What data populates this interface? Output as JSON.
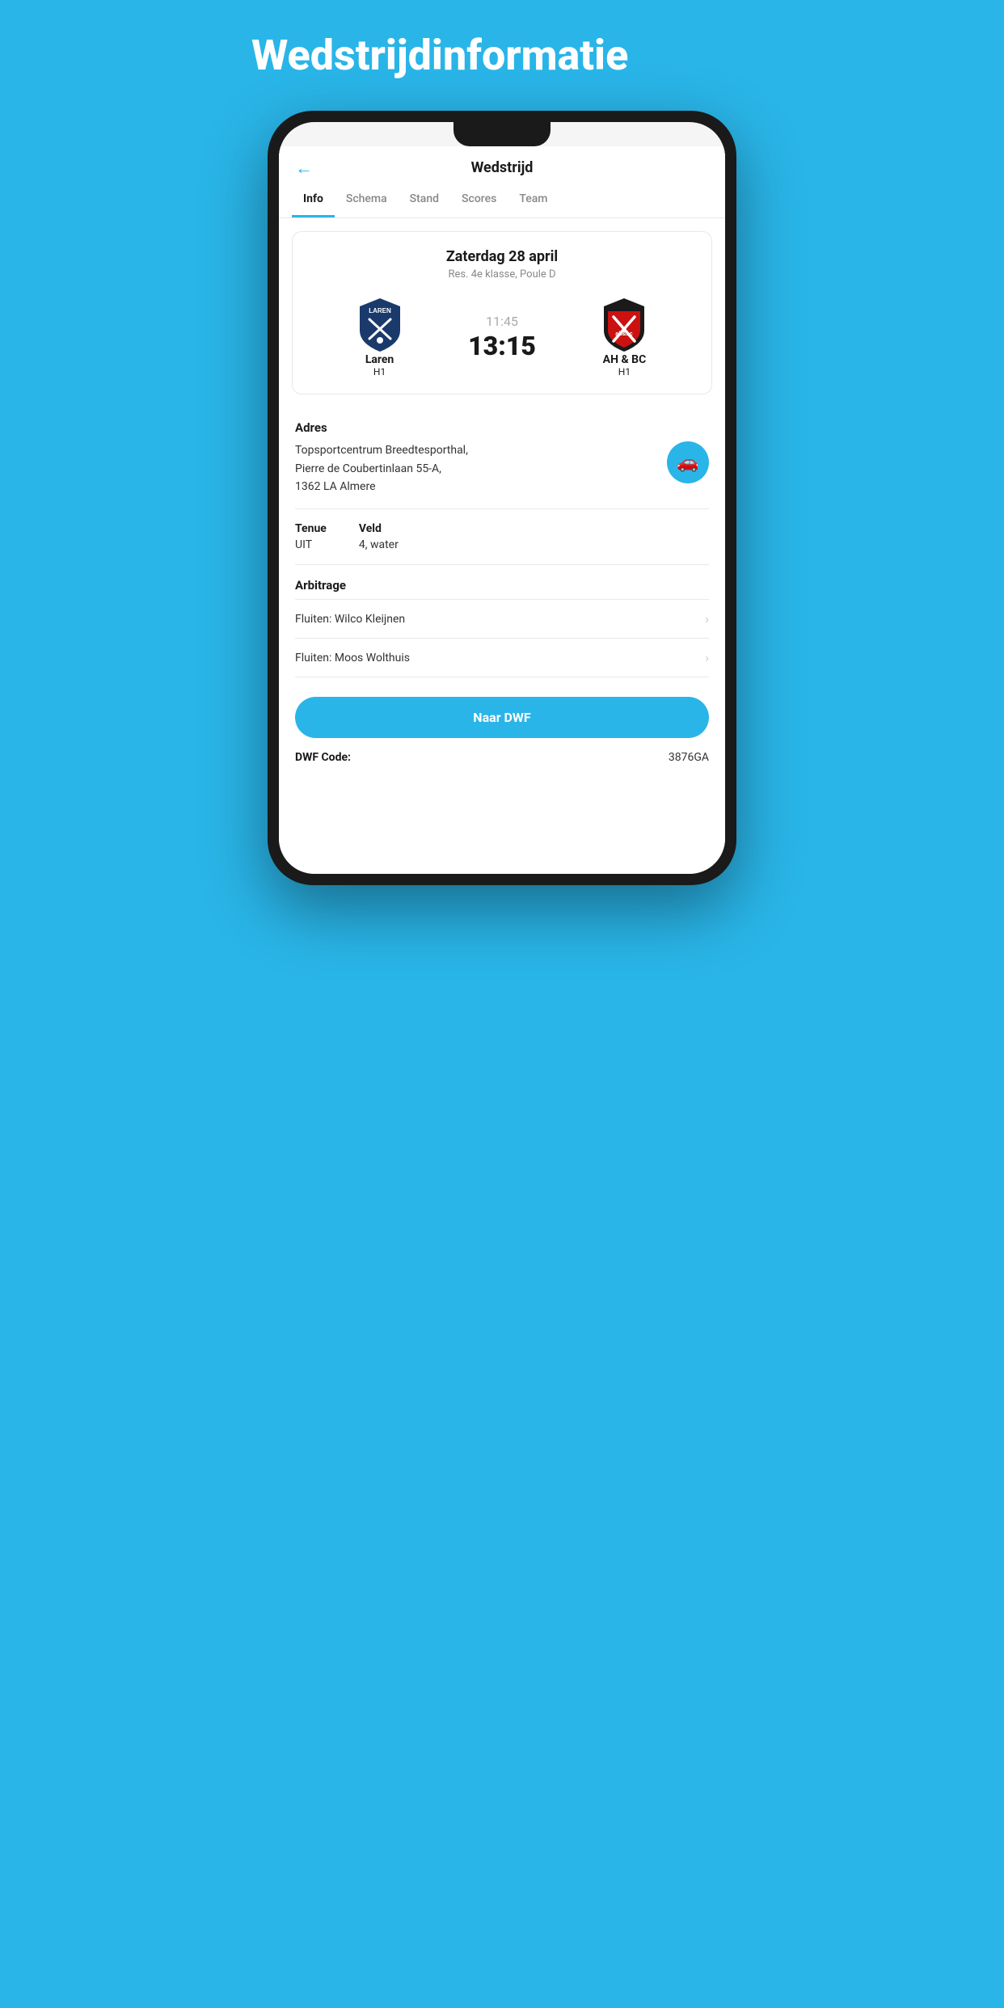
{
  "pageTitle": "Wedstrijdinformatie",
  "header": {
    "title": "Wedstrijd",
    "backLabel": "←"
  },
  "tabs": [
    {
      "id": "info",
      "label": "Info",
      "active": true
    },
    {
      "id": "schema",
      "label": "Schema",
      "active": false
    },
    {
      "id": "stand",
      "label": "Stand",
      "active": false
    },
    {
      "id": "scores",
      "label": "Scores",
      "active": false
    },
    {
      "id": "team",
      "label": "Team",
      "active": false
    }
  ],
  "match": {
    "date": "Zaterdag 28 april",
    "competition": "Res. 4e klasse, Poule D",
    "timeScheduled": "11:45",
    "timeActual": "13:15",
    "homeTeam": {
      "name": "Laren",
      "sub": "H1"
    },
    "awayTeam": {
      "name": "AH & BC",
      "sub": "H1"
    }
  },
  "info": {
    "addressLabel": "Adres",
    "addressText": "Topsportcentrum Breedtesporthal,\nPierre de Coubertinlaan 55-A,\n1362 LA Almere",
    "tenueLabel": "Tenue",
    "tenueValue": "UIT",
    "veldLabel": "Veld",
    "veldValue": "4, water",
    "arbitrageLabel": "Arbitrage",
    "arbiters": [
      {
        "label": "Fluiten: Wilco Kleijnen"
      },
      {
        "label": "Fluiten: Moos Wolthuis"
      }
    ],
    "naarDWFLabel": "Naar DWF",
    "dwfCodeLabel": "DWF Code:",
    "dwfCodeValue": "3876GA"
  },
  "colors": {
    "accent": "#29b5e8",
    "dark": "#1a1a1a",
    "gray": "#888888"
  }
}
